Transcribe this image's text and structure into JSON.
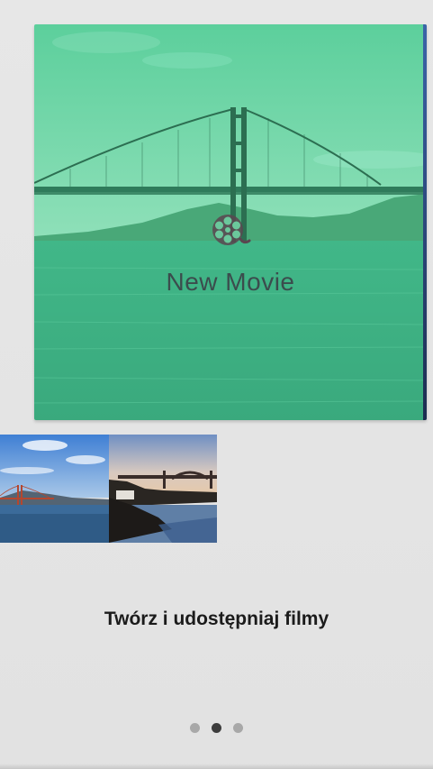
{
  "movie_card": {
    "title": "New Movie",
    "icon": "film-reel-icon",
    "tint_color": "#5fd6a4"
  },
  "thumbnails": [
    {
      "icon": "golden-gate-bay-thumbnail"
    },
    {
      "icon": "bridge-shore-sunset-thumbnail"
    }
  ],
  "caption": "Twórz i udostępniaj filmy",
  "pagination": {
    "total": 3,
    "current": 2
  },
  "colors": {
    "background": "#e6e6e6",
    "dot_active": "#3d3d3d",
    "dot_inactive": "#a8a8a8"
  }
}
